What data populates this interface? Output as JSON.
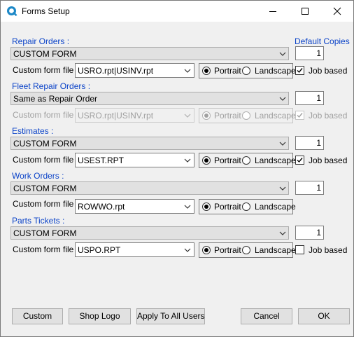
{
  "window": {
    "title": "Forms Setup"
  },
  "default_copies_label": "Default Copies",
  "sections": [
    {
      "label": "Repair Orders :",
      "form": "CUSTOM FORM",
      "copies": "1",
      "custom_file_label": "Custom form file :",
      "custom_file": "USRO.rpt|USINV.rpt",
      "portrait": "Portrait",
      "landscape": "Landscape",
      "orientation": "Portrait",
      "job_based_label": "Job based",
      "job_based": true
    },
    {
      "label": "Fleet Repair Orders :",
      "form": "Same as Repair Order",
      "copies": "1",
      "custom_file_label": "Custom form file :",
      "custom_file": "USRO.rpt|USINV.rpt",
      "portrait": "Portrait",
      "landscape": "Landscape",
      "orientation": "Portrait",
      "job_based_label": "Job based",
      "job_based": true,
      "disabled": true
    },
    {
      "label": "Estimates :",
      "form": "CUSTOM FORM",
      "copies": "1",
      "custom_file_label": "Custom form file :",
      "custom_file": "USEST.RPT",
      "portrait": "Portrait",
      "landscape": "Landscape",
      "orientation": "Portrait",
      "job_based_label": "Job based",
      "job_based": true
    },
    {
      "label": "Work Orders :",
      "form": "CUSTOM FORM",
      "copies": "1",
      "custom_file_label": "Custom form file :",
      "custom_file": "ROWWO.rpt",
      "portrait": "Portrait",
      "landscape": "Landscape",
      "orientation": "Portrait"
    },
    {
      "label": "Parts Tickets :",
      "form": "CUSTOM FORM",
      "copies": "1",
      "custom_file_label": "Custom form file :",
      "custom_file": "USPO.RPT",
      "portrait": "Portrait",
      "landscape": "Landscape",
      "orientation": "Portrait",
      "job_based_label": "Job based",
      "job_based": false
    }
  ],
  "buttons": {
    "custom": "Custom",
    "shop_logo": "Shop Logo",
    "apply_all": "Apply To All Users",
    "cancel": "Cancel",
    "ok": "OK"
  }
}
